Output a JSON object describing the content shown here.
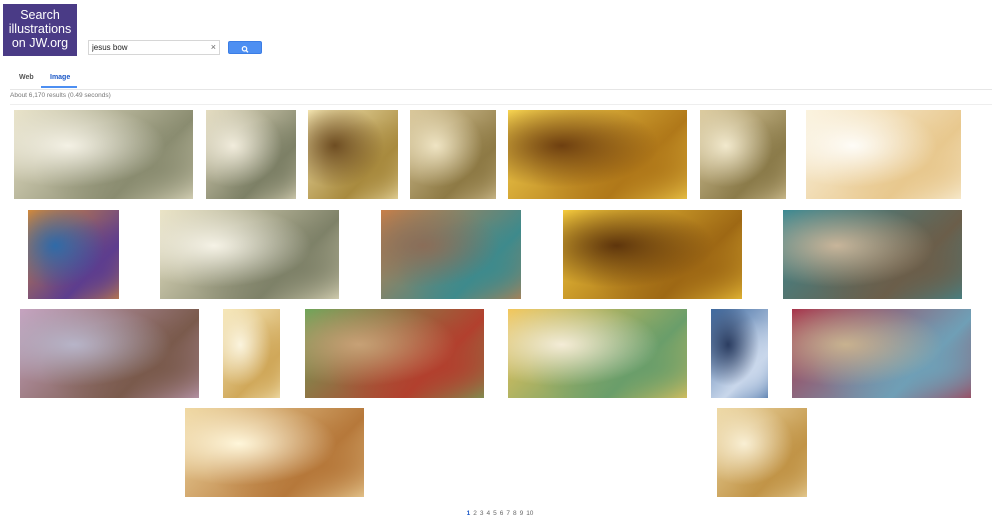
{
  "logo": {
    "line1": "Search",
    "line2": "illustrations",
    "line3": "on JW.org"
  },
  "search": {
    "query": "jesus bow",
    "clear_glyph": "×",
    "button_icon": "search-icon"
  },
  "tabs": [
    {
      "label": "Web"
    },
    {
      "label": "Image",
      "active": true
    }
  ],
  "results": {
    "stats": "About 6,170 results (0.49 seconds)"
  },
  "images": [
    {
      "subject": "rider-white-horse-bow",
      "colors": [
        "#e9e3c9",
        "#8a8c70",
        "#f4f1e5"
      ]
    },
    {
      "subject": "rider-white-horse-bow",
      "colors": [
        "#e4dcc0",
        "#7d8066",
        "#f1ecdc"
      ]
    },
    {
      "subject": "white-horse-charging",
      "colors": [
        "#f3e4b0",
        "#a88a3e",
        "#6e4d22"
      ]
    },
    {
      "subject": "four-horsemen",
      "colors": [
        "#d9c79a",
        "#8e7a45",
        "#efe4c3"
      ]
    },
    {
      "subject": "golden-light-clouds",
      "colors": [
        "#f7d451",
        "#b07819",
        "#6e3f10"
      ]
    },
    {
      "subject": "four-horsemen",
      "colors": [
        "#dccb9f",
        "#8b7b4a",
        "#f2e9cd"
      ]
    },
    {
      "subject": "angel-with-sword",
      "colors": [
        "#fbf3df",
        "#e8c88e",
        "#fefcf7"
      ]
    },
    {
      "subject": "king-on-throne",
      "colors": [
        "#d38a3a",
        "#5d3d8e",
        "#2f6aa8"
      ]
    },
    {
      "subject": "rider-white-horse-bow",
      "colors": [
        "#ebe4c6",
        "#7e8168",
        "#f5f2e6"
      ]
    },
    {
      "subject": "jesus-pointing",
      "colors": [
        "#c97f48",
        "#3e8a8c",
        "#8a6d58"
      ]
    },
    {
      "subject": "golden-light-clouds",
      "colors": [
        "#f5cb3e",
        "#9e6814",
        "#5e350c"
      ]
    },
    {
      "subject": "jesus-with-disciples",
      "colors": [
        "#3c8a93",
        "#6b5e4a",
        "#c8b59a"
      ]
    },
    {
      "subject": "crowd-seated-listening",
      "colors": [
        "#c6a3c0",
        "#7a5a4c",
        "#b7b4c8"
      ]
    },
    {
      "subject": "rider-golden-glow",
      "colors": [
        "#f6e7b8",
        "#d0a85a",
        "#fbf4de"
      ]
    },
    {
      "subject": "jesus-teaching-crowd",
      "colors": [
        "#6fa65a",
        "#b2402e",
        "#c7a176"
      ]
    },
    {
      "subject": "horseman-and-family",
      "colors": [
        "#f3c75b",
        "#6a9e6a",
        "#f4ecd7"
      ]
    },
    {
      "subject": "jesus-oval-portrait",
      "colors": [
        "#3f6aa0",
        "#c9d7eb",
        "#2b3d61"
      ]
    },
    {
      "subject": "jesus-woman-at-well",
      "colors": [
        "#a8344a",
        "#6f9fb6",
        "#c8b28f"
      ]
    },
    {
      "subject": "army-of-riders",
      "colors": [
        "#f0d9a3",
        "#b6783a",
        "#fff6da"
      ]
    },
    {
      "subject": "rider-white-horse-bow",
      "colors": [
        "#eed9a6",
        "#c19447",
        "#f9efd4"
      ]
    }
  ],
  "pagination": [
    "1",
    "2",
    "3",
    "4",
    "5",
    "6",
    "7",
    "8",
    "9",
    "10"
  ]
}
